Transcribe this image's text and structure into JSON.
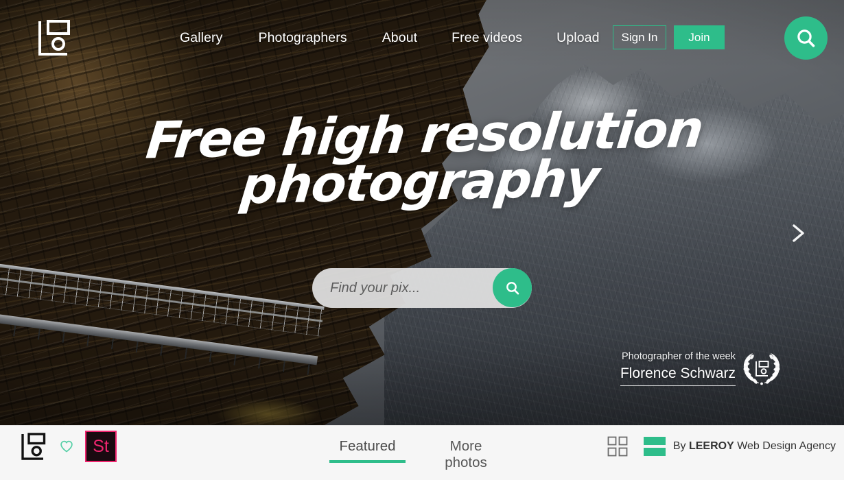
{
  "brand": {
    "logo_icon": "camera-frame-logo-icon",
    "accent_color": "#2ebd8a",
    "stock_pink": "#f0256f"
  },
  "nav": {
    "links": [
      {
        "label": "Gallery"
      },
      {
        "label": "Photographers"
      },
      {
        "label": "About"
      },
      {
        "label": "Free videos"
      },
      {
        "label": "Upload"
      }
    ],
    "sign_in_label": "Sign In",
    "join_label": "Join",
    "search_icon": "search-icon"
  },
  "hero": {
    "title": "Free high resolution\nphotography",
    "search": {
      "placeholder": "Find your pix...",
      "value": "",
      "submit_icon": "search-icon"
    },
    "next_slide_icon": "chevron-right-icon",
    "photographer_of_week": {
      "label": "Photographer of the week",
      "name": "Florence Schwarz",
      "badge_icon": "laurel-wreath-award-icon"
    }
  },
  "bottom_bar": {
    "logo_icon": "camera-frame-logo-icon",
    "favorite_icon": "heart-outline-icon",
    "stock_badge": {
      "label": "St",
      "icon": "adobe-stock-icon"
    },
    "tabs": [
      {
        "label": "Featured",
        "active": true
      },
      {
        "label": "More photos",
        "active": false
      }
    ],
    "grid_icon": "grid-view-icon",
    "agency_mark_icon": "leeroy-bars-icon",
    "credit_prefix": "By ",
    "credit_brand": "LEEROY",
    "credit_suffix": " Web Design Agency"
  }
}
